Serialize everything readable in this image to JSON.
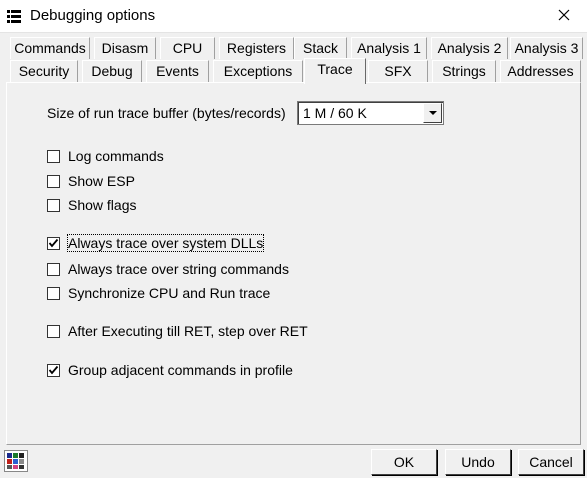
{
  "window": {
    "title": "Debugging options"
  },
  "tabs_row1": [
    "Commands",
    "Disasm",
    "CPU",
    "Registers",
    "Stack",
    "Analysis 1",
    "Analysis 2",
    "Analysis 3"
  ],
  "tabs_row2": [
    "Security",
    "Debug",
    "Events",
    "Exceptions",
    "Trace",
    "SFX",
    "Strings",
    "Addresses"
  ],
  "active_tab": "Trace",
  "trace": {
    "buffer_label": "Size of run trace buffer (bytes/records)",
    "buffer_value": "1 M / 60 K",
    "options": [
      {
        "label": "Log commands",
        "checked": false
      },
      {
        "label": "Show ESP",
        "checked": false
      },
      {
        "label": "Show flags",
        "checked": false
      },
      {
        "label": "Always trace over system DLLs",
        "checked": true
      },
      {
        "label": "Always trace over string commands",
        "checked": false
      },
      {
        "label": "Synchronize CPU and Run trace",
        "checked": false
      },
      {
        "label": "After Executing till RET, step over RET",
        "checked": false
      },
      {
        "label": "Group adjacent commands in profile",
        "checked": true
      }
    ]
  },
  "buttons": {
    "ok": "OK",
    "undo": "Undo",
    "cancel": "Cancel"
  }
}
